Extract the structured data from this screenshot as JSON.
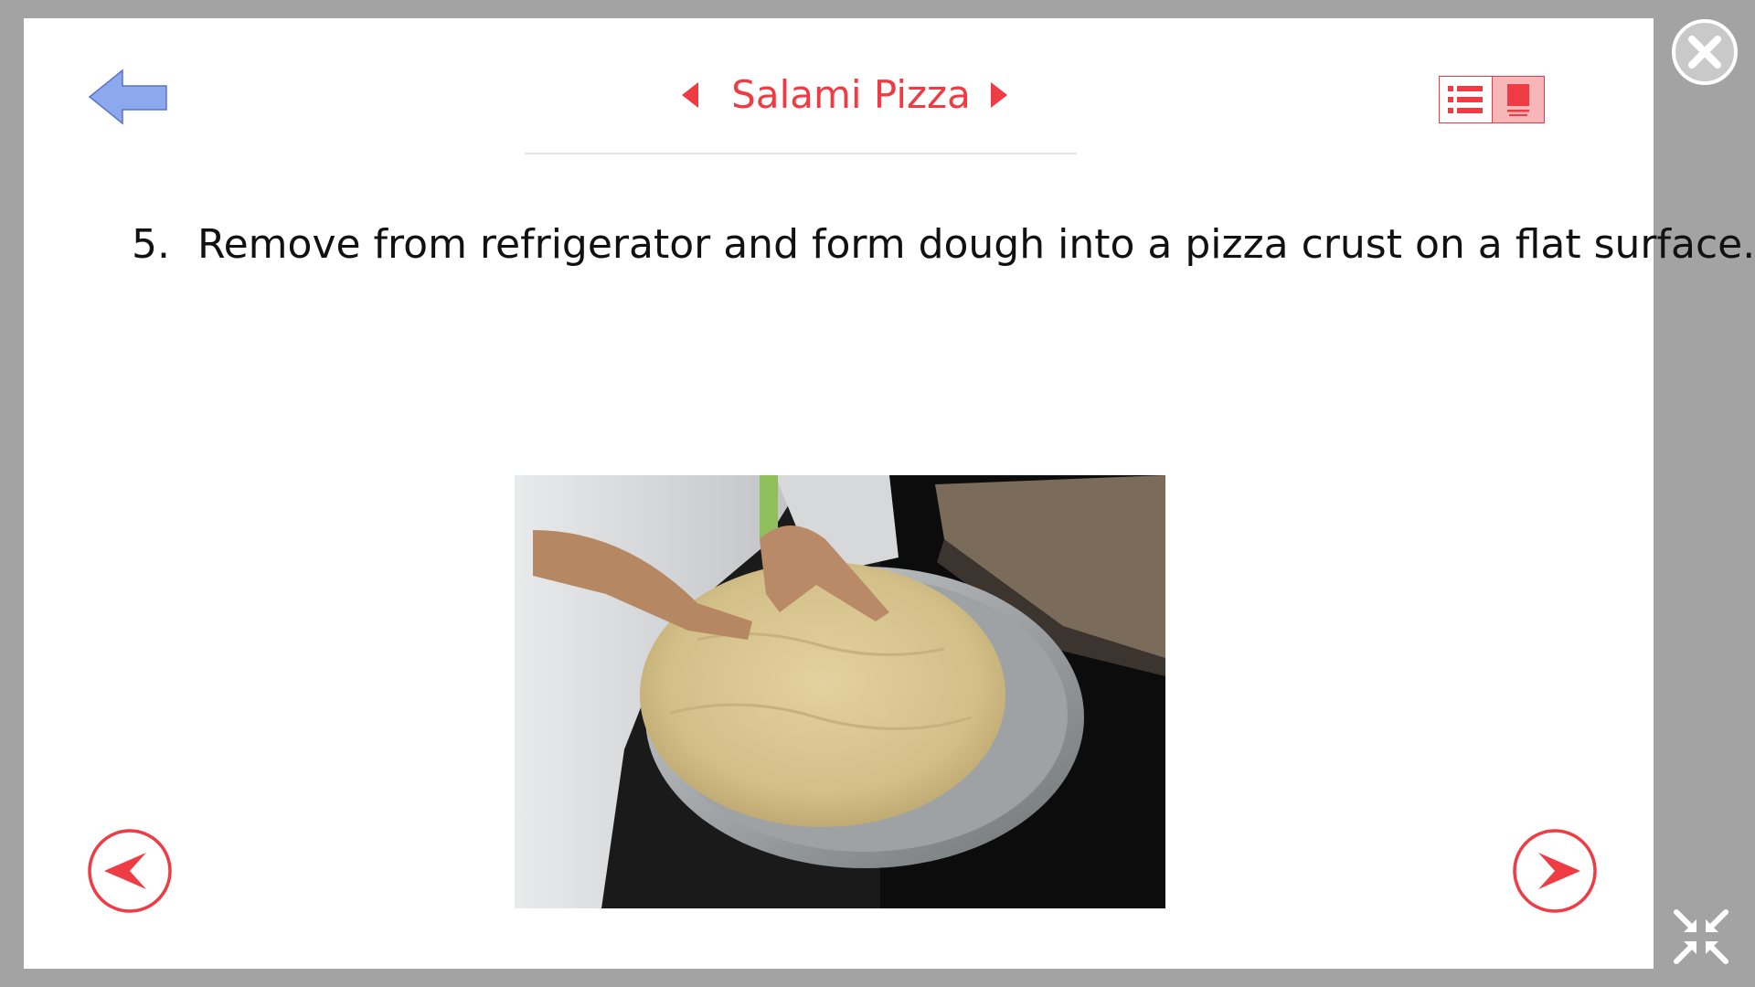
{
  "header": {
    "title": "Salami Pizza",
    "back_icon": "back-arrow-icon",
    "prev_recipe_icon": "caret-left-icon",
    "next_recipe_icon": "caret-right-icon"
  },
  "view_toggle": {
    "options": [
      {
        "icon": "list-view-icon",
        "active": false
      },
      {
        "icon": "slide-view-icon",
        "active": true
      }
    ]
  },
  "step": {
    "number": "5.",
    "text": "Remove from refrigerator and form dough into a pizza crust on a flat surface."
  },
  "navigation": {
    "prev_icon": "circle-arrow-left-icon",
    "next_icon": "circle-arrow-right-icon"
  },
  "window": {
    "close_icon": "close-icon",
    "collapse_icon": "collapse-icon"
  },
  "colors": {
    "accent": "#ef3b43",
    "accent_light": "#f7b7b9",
    "back_arrow_fill": "#8ca9ee",
    "frame": "#a3a3a3"
  }
}
